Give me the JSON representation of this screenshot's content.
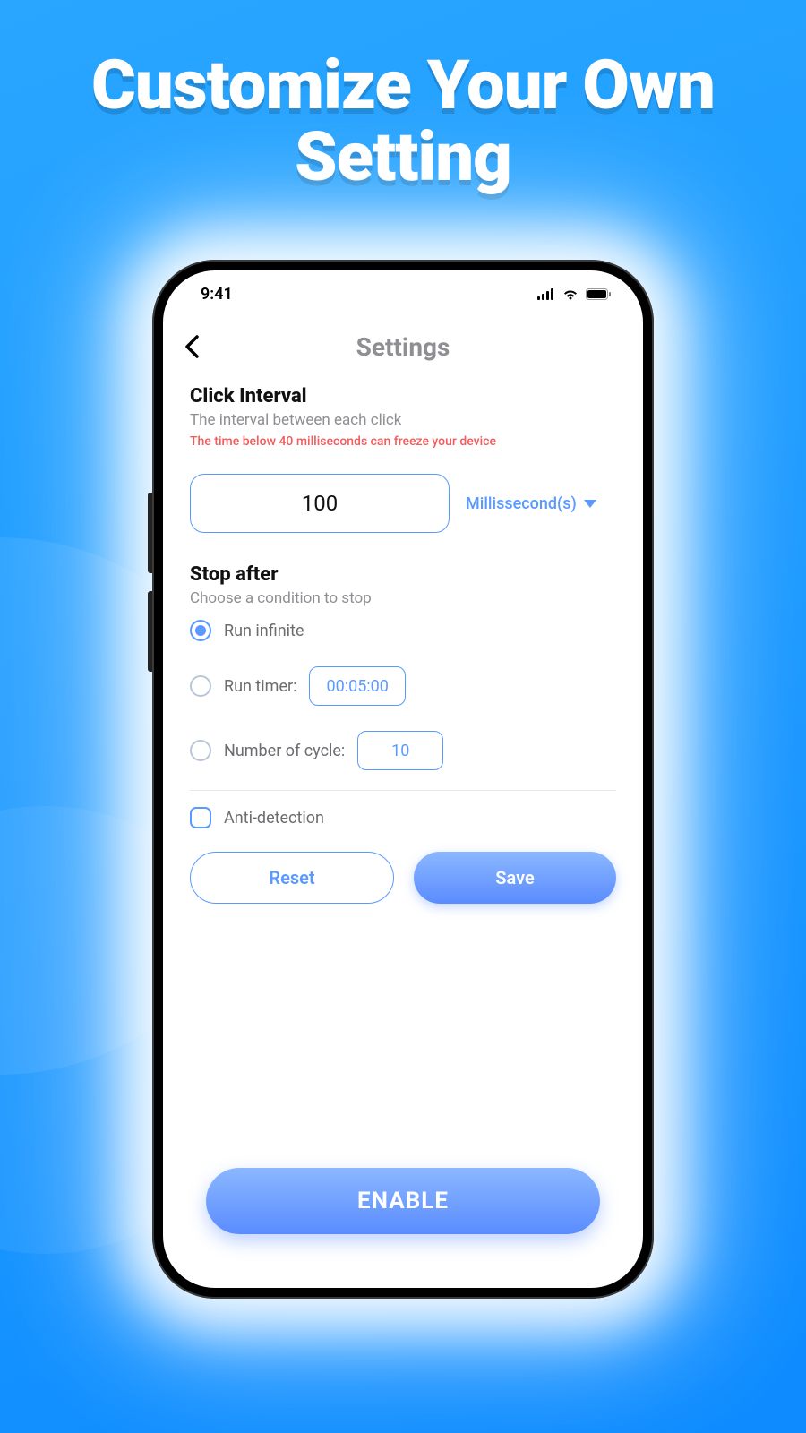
{
  "promo": {
    "headline": "Customize Your Own Setting"
  },
  "status": {
    "time": "9:41"
  },
  "nav": {
    "title": "Settings"
  },
  "interval": {
    "title": "Click Interval",
    "subtitle": "The interval between each click",
    "warning": "The time below 40 milliseconds can freeze your device",
    "value": "100",
    "unit": "Millissecond(s)"
  },
  "stop": {
    "title": "Stop after",
    "subtitle": "Choose a condition to stop",
    "options": {
      "infinite": "Run infinite",
      "timer_label": "Run timer:",
      "timer_value": "00:05:00",
      "cycle_label": "Number of cycle:",
      "cycle_value": "10"
    }
  },
  "anti_detection": {
    "label": "Anti-detection"
  },
  "buttons": {
    "reset": "Reset",
    "save": "Save",
    "enable": "ENABLE"
  }
}
